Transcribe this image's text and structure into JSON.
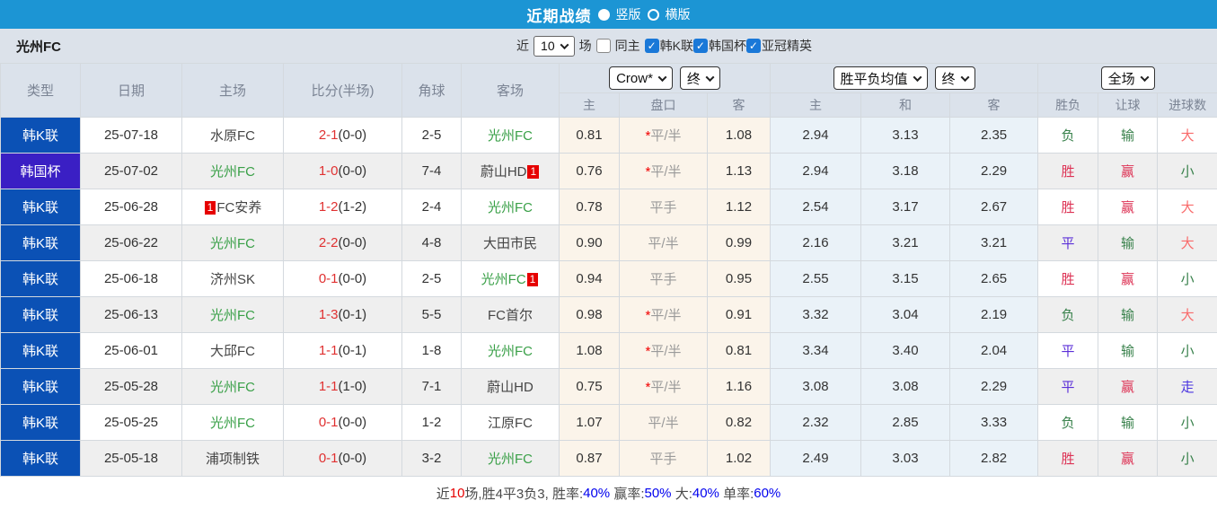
{
  "palette": {
    "topbar_bg": "#1c95d4",
    "league_badge": "#0b51b5",
    "cup_badge": "#3a1fc4",
    "team_green": "#3aa048",
    "score_red": "#e03131",
    "card_red": "#e60000",
    "red": "#dd3355",
    "violet": "#5b2fd8",
    "green": "#38814b",
    "lightred": "#f96b6b",
    "blue": "#4a34e0",
    "pct_blue": "#0000ee",
    "num_red": "#e60000"
  },
  "titlebar": {
    "title": "近期战绩",
    "radio_selected_label": "竖版",
    "radio_unselected_label": "横版"
  },
  "filter": {
    "team": "光州FC",
    "near_label": "近",
    "count_value": "10",
    "games_label": "场",
    "same_home_label": "同主",
    "leagues": [
      "韩K联",
      "韩国杯",
      "亚冠精英"
    ]
  },
  "table": {
    "headers_left": [
      "类型",
      "日期",
      "主场",
      "比分(半场)",
      "角球",
      "客场"
    ],
    "group1": {
      "select1": "Crow*",
      "select2": "终",
      "cols": [
        "主",
        "盘口",
        "客"
      ]
    },
    "group2": {
      "select1": "胜平负均值",
      "select2": "终",
      "cols": [
        "主",
        "和",
        "客"
      ]
    },
    "group3": {
      "select1": "全场",
      "cols": [
        "胜负",
        "让球",
        "进球数"
      ]
    },
    "rows": [
      {
        "comp": "韩K联",
        "compType": "league",
        "date": "25-07-18",
        "home": {
          "name": "水原FC",
          "green": false,
          "card": ""
        },
        "score": "2-1",
        "half": "(0-0)",
        "corner": "2-5",
        "away": {
          "name": "光州FC",
          "green": true,
          "card": ""
        },
        "crowHome": "0.81",
        "star": true,
        "handicap": "平/半",
        "crowAway": "1.08",
        "avgHome": "2.94",
        "avgDraw": "3.13",
        "avgAway": "2.35",
        "resWdl": {
          "t": "负",
          "c": "green"
        },
        "resHc": {
          "t": "输",
          "c": "green"
        },
        "resGoals": {
          "t": "大",
          "c": "lightred"
        }
      },
      {
        "comp": "韩国杯",
        "compType": "cup",
        "date": "25-07-02",
        "home": {
          "name": "光州FC",
          "green": true,
          "card": ""
        },
        "score": "1-0",
        "half": "(0-0)",
        "corner": "7-4",
        "away": {
          "name": "蔚山HD",
          "green": false,
          "card": "1"
        },
        "crowHome": "0.76",
        "star": true,
        "handicap": "平/半",
        "crowAway": "1.13",
        "avgHome": "2.94",
        "avgDraw": "3.18",
        "avgAway": "2.29",
        "resWdl": {
          "t": "胜",
          "c": "red"
        },
        "resHc": {
          "t": "赢",
          "c": "red"
        },
        "resGoals": {
          "t": "小",
          "c": "green"
        }
      },
      {
        "comp": "韩K联",
        "compType": "league",
        "date": "25-06-28",
        "home": {
          "name": "FC安养",
          "green": false,
          "card": "1",
          "cardBefore": true
        },
        "score": "1-2",
        "half": "(1-2)",
        "corner": "2-4",
        "away": {
          "name": "光州FC",
          "green": true,
          "card": ""
        },
        "crowHome": "0.78",
        "star": false,
        "handicap": "平手",
        "crowAway": "1.12",
        "avgHome": "2.54",
        "avgDraw": "3.17",
        "avgAway": "2.67",
        "resWdl": {
          "t": "胜",
          "c": "red"
        },
        "resHc": {
          "t": "赢",
          "c": "red"
        },
        "resGoals": {
          "t": "大",
          "c": "lightred"
        }
      },
      {
        "comp": "韩K联",
        "compType": "league",
        "date": "25-06-22",
        "home": {
          "name": "光州FC",
          "green": true,
          "card": ""
        },
        "score": "2-2",
        "half": "(0-0)",
        "corner": "4-8",
        "away": {
          "name": "大田市民",
          "green": false,
          "card": ""
        },
        "crowHome": "0.90",
        "star": false,
        "handicap": "平/半",
        "crowAway": "0.99",
        "avgHome": "2.16",
        "avgDraw": "3.21",
        "avgAway": "3.21",
        "resWdl": {
          "t": "平",
          "c": "violet"
        },
        "resHc": {
          "t": "输",
          "c": "green"
        },
        "resGoals": {
          "t": "大",
          "c": "lightred"
        }
      },
      {
        "comp": "韩K联",
        "compType": "league",
        "date": "25-06-18",
        "home": {
          "name": "济州SK",
          "green": false,
          "card": ""
        },
        "score": "0-1",
        "half": "(0-0)",
        "corner": "2-5",
        "away": {
          "name": "光州FC",
          "green": true,
          "card": "1"
        },
        "crowHome": "0.94",
        "star": false,
        "handicap": "平手",
        "crowAway": "0.95",
        "avgHome": "2.55",
        "avgDraw": "3.15",
        "avgAway": "2.65",
        "resWdl": {
          "t": "胜",
          "c": "red"
        },
        "resHc": {
          "t": "赢",
          "c": "red"
        },
        "resGoals": {
          "t": "小",
          "c": "green"
        }
      },
      {
        "comp": "韩K联",
        "compType": "league",
        "date": "25-06-13",
        "home": {
          "name": "光州FC",
          "green": true,
          "card": ""
        },
        "score": "1-3",
        "half": "(0-1)",
        "corner": "5-5",
        "away": {
          "name": "FC首尔",
          "green": false,
          "card": ""
        },
        "crowHome": "0.98",
        "star": true,
        "handicap": "平/半",
        "crowAway": "0.91",
        "avgHome": "3.32",
        "avgDraw": "3.04",
        "avgAway": "2.19",
        "resWdl": {
          "t": "负",
          "c": "green"
        },
        "resHc": {
          "t": "输",
          "c": "green"
        },
        "resGoals": {
          "t": "大",
          "c": "lightred"
        }
      },
      {
        "comp": "韩K联",
        "compType": "league",
        "date": "25-06-01",
        "home": {
          "name": "大邱FC",
          "green": false,
          "card": ""
        },
        "score": "1-1",
        "half": "(0-1)",
        "corner": "1-8",
        "away": {
          "name": "光州FC",
          "green": true,
          "card": ""
        },
        "crowHome": "1.08",
        "star": true,
        "handicap": "平/半",
        "crowAway": "0.81",
        "avgHome": "3.34",
        "avgDraw": "3.40",
        "avgAway": "2.04",
        "resWdl": {
          "t": "平",
          "c": "violet"
        },
        "resHc": {
          "t": "输",
          "c": "green"
        },
        "resGoals": {
          "t": "小",
          "c": "green"
        }
      },
      {
        "comp": "韩K联",
        "compType": "league",
        "date": "25-05-28",
        "home": {
          "name": "光州FC",
          "green": true,
          "card": ""
        },
        "score": "1-1",
        "half": "(1-0)",
        "corner": "7-1",
        "away": {
          "name": "蔚山HD",
          "green": false,
          "card": ""
        },
        "crowHome": "0.75",
        "star": true,
        "handicap": "平/半",
        "crowAway": "1.16",
        "avgHome": "3.08",
        "avgDraw": "3.08",
        "avgAway": "2.29",
        "resWdl": {
          "t": "平",
          "c": "violet"
        },
        "resHc": {
          "t": "赢",
          "c": "red"
        },
        "resGoals": {
          "t": "走",
          "c": "blue"
        }
      },
      {
        "comp": "韩K联",
        "compType": "league",
        "date": "25-05-25",
        "home": {
          "name": "光州FC",
          "green": true,
          "card": ""
        },
        "score": "0-1",
        "half": "(0-0)",
        "corner": "1-2",
        "away": {
          "name": "江原FC",
          "green": false,
          "card": ""
        },
        "crowHome": "1.07",
        "star": false,
        "handicap": "平/半",
        "crowAway": "0.82",
        "avgHome": "2.32",
        "avgDraw": "2.85",
        "avgAway": "3.33",
        "resWdl": {
          "t": "负",
          "c": "green"
        },
        "resHc": {
          "t": "输",
          "c": "green"
        },
        "resGoals": {
          "t": "小",
          "c": "green"
        }
      },
      {
        "comp": "韩K联",
        "compType": "league",
        "date": "25-05-18",
        "home": {
          "name": "浦项制铁",
          "green": false,
          "card": ""
        },
        "score": "0-1",
        "half": "(0-0)",
        "corner": "3-2",
        "away": {
          "name": "光州FC",
          "green": true,
          "card": ""
        },
        "crowHome": "0.87",
        "star": false,
        "handicap": "平手",
        "crowAway": "1.02",
        "avgHome": "2.49",
        "avgDraw": "3.03",
        "avgAway": "2.82",
        "resWdl": {
          "t": "胜",
          "c": "red"
        },
        "resHc": {
          "t": "赢",
          "c": "red"
        },
        "resGoals": {
          "t": "小",
          "c": "green"
        }
      }
    ]
  },
  "footer": {
    "segments": [
      {
        "text": "近",
        "color": "#4a4a4a"
      },
      {
        "text": "10",
        "color": "#e60000"
      },
      {
        "text": "场,胜4平3负3, 胜率:",
        "color": "#4a4a4a"
      },
      {
        "text": "40%",
        "color": "#0000ee"
      },
      {
        "text": " 赢率:",
        "color": "#4a4a4a"
      },
      {
        "text": "50%",
        "color": "#0000ee"
      },
      {
        "text": " 大:",
        "color": "#4a4a4a"
      },
      {
        "text": "40%",
        "color": "#0000ee"
      },
      {
        "text": " 单率:",
        "color": "#4a4a4a"
      },
      {
        "text": "60%",
        "color": "#0000ee"
      }
    ]
  }
}
